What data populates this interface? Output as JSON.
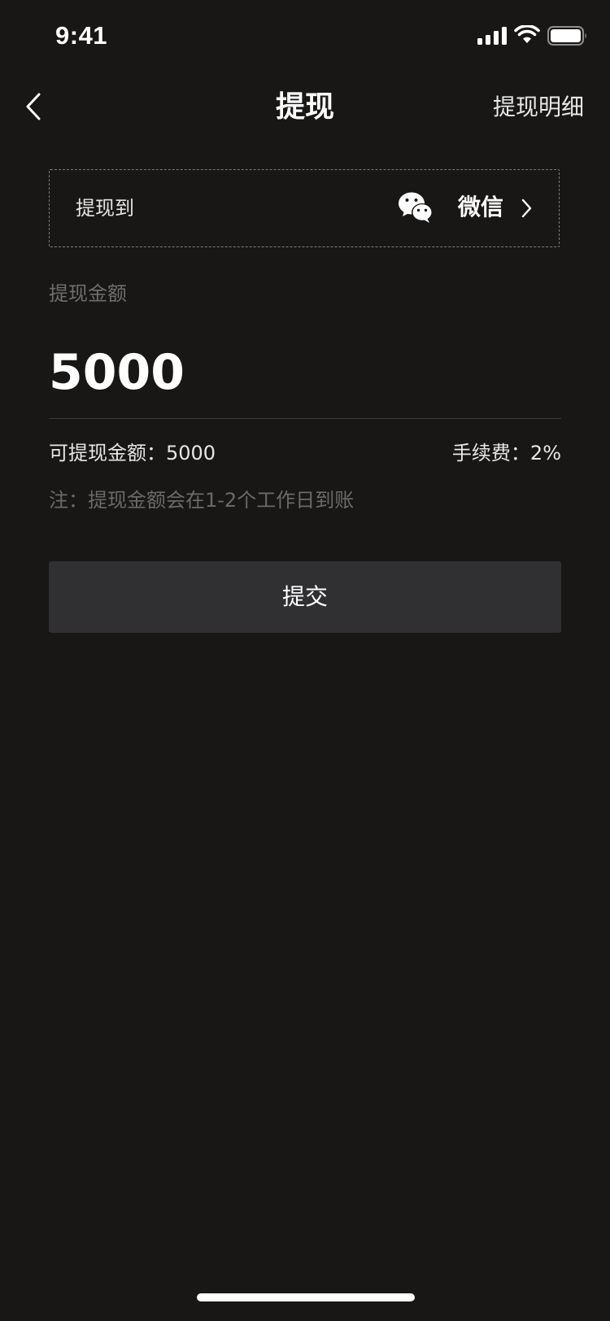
{
  "status_bar": {
    "time": "9:41",
    "icons": [
      "signal-icon",
      "wifi-icon",
      "battery-icon"
    ]
  },
  "nav": {
    "back_icon": "chevron-left-icon",
    "title": "提现",
    "right_link": "提现明细"
  },
  "withdraw_to": {
    "label": "提现到",
    "method_icon": "wechat-icon",
    "method_name": "微信",
    "chevron_icon": "chevron-right-icon"
  },
  "amount": {
    "label": "提现金额",
    "value": "5000"
  },
  "info": {
    "available": "可提现金额：5000",
    "fee": "手续费：2%",
    "note": "注：提现金额会在1-2个工作日到账"
  },
  "submit": {
    "label": "提交"
  },
  "colors": {
    "background": "#181716",
    "button": "#302f31",
    "muted_text": "#6e6e6e"
  }
}
